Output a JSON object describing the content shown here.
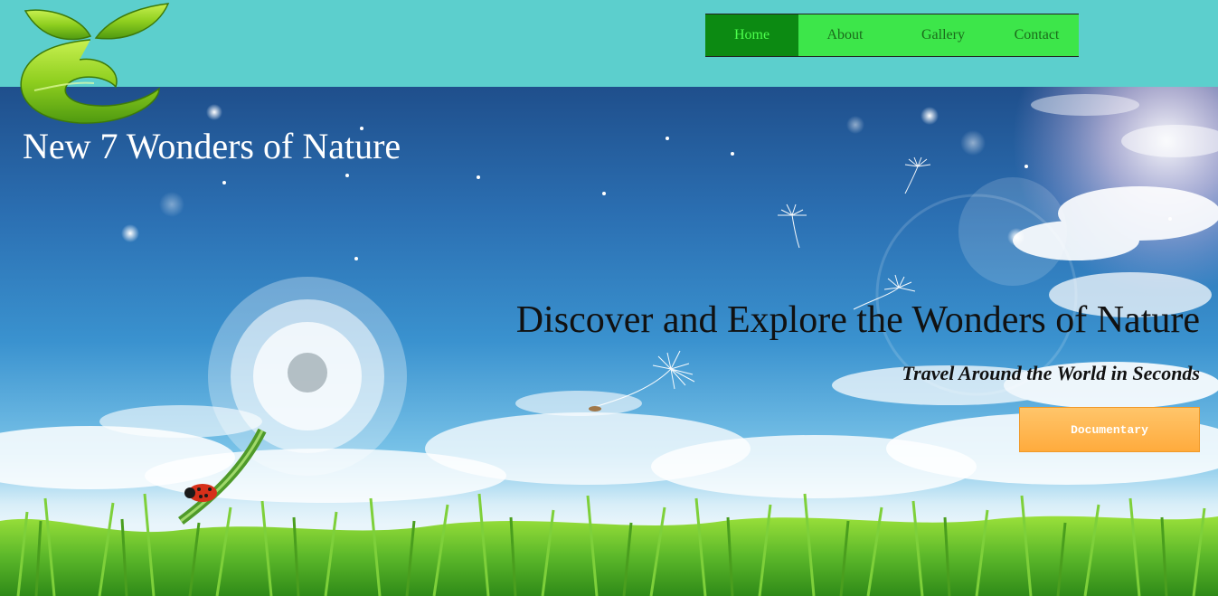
{
  "header": {
    "logo_icon": "green-leaf-sprout-logo",
    "nav": {
      "items": [
        {
          "label": "Home",
          "active": true
        },
        {
          "label": "About",
          "active": false
        },
        {
          "label": "Gallery",
          "active": false
        },
        {
          "label": "Contact",
          "active": false
        }
      ]
    }
  },
  "hero": {
    "site_title": "New 7 Wonders of Nature",
    "headline": "Discover and Explore the Wonders of Nature",
    "subheadline": "Travel Around the World in Seconds",
    "cta_label": "Documentary"
  },
  "colors": {
    "topbar": "#5ccfcd",
    "nav_bg": "#3de64a",
    "nav_active": "#0c8a12",
    "cta": "#ffab3d"
  }
}
